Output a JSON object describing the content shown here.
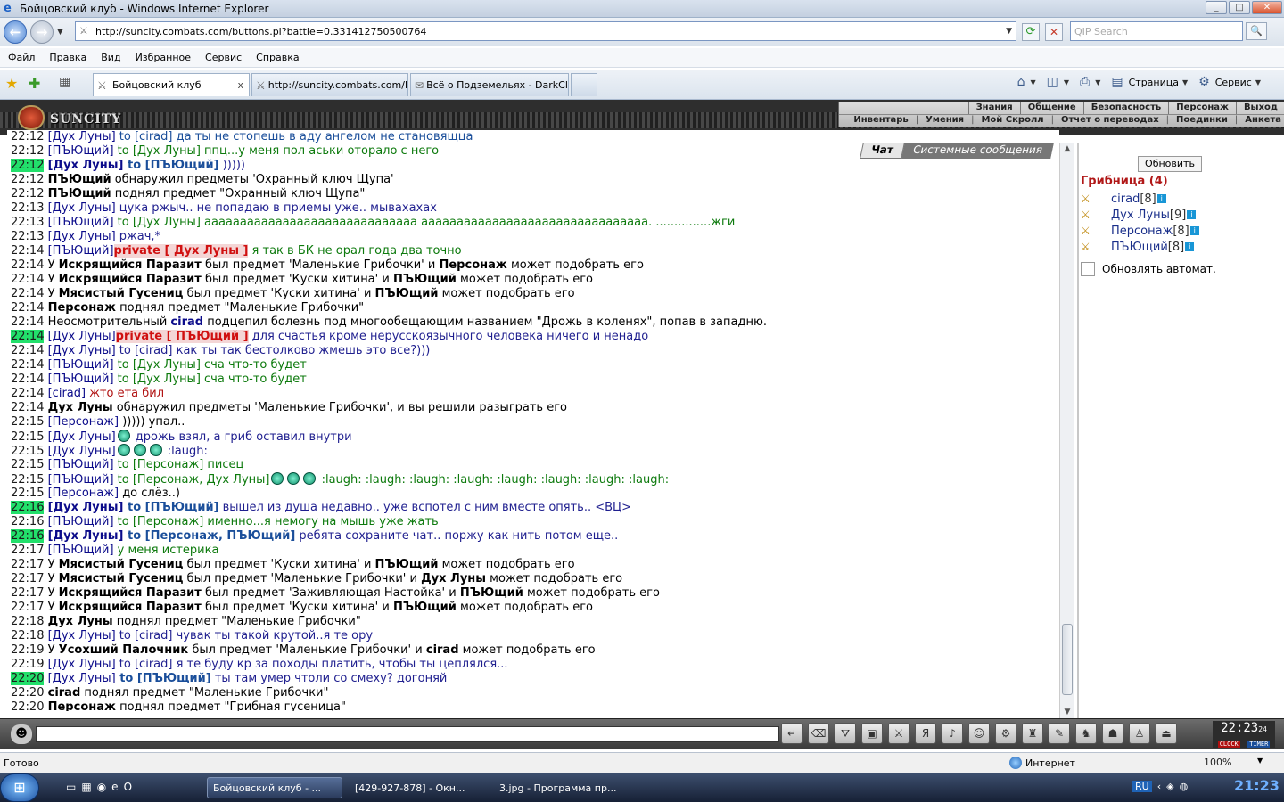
{
  "window": {
    "title": "Бойцовский клуб - Windows Internet Explorer"
  },
  "address": {
    "url": "http://suncity.combats.com/buttons.pl?battle=0.331412750500764",
    "search_placeholder": "QIP Search"
  },
  "menu": [
    "Файл",
    "Правка",
    "Вид",
    "Избранное",
    "Сервис",
    "Справка"
  ],
  "tabs": [
    {
      "label": "Бойцовский клуб",
      "close": "x"
    },
    {
      "label": "http://suncity.combats.com/l..."
    },
    {
      "label": "Всё о Подземельях - DarkCl..."
    }
  ],
  "toolbar_right": {
    "page": "Страница",
    "service": "Сервис"
  },
  "site": {
    "logo": "SUNCITY",
    "nav1": [
      "Знания",
      "Общение",
      "Безопасность",
      "Персонаж",
      "Выход"
    ],
    "nav2": [
      "Инвентарь",
      "Умения",
      "Мой Скролл",
      "Отчет о переводах",
      "Поединки",
      "Анкета"
    ]
  },
  "chat_tabs": [
    "Чат",
    "Системные сообщения"
  ],
  "chat": [
    {
      "t": "22:12",
      "parts": [
        [
          "nm",
          "[Дух Луны]"
        ],
        [
          "to",
          " to [cirad] да ты не стопешь в аду ангелом не становящца"
        ]
      ]
    },
    {
      "t": "22:12",
      "parts": [
        [
          "nm",
          "[ПЪЮщий]"
        ],
        [
          "gm",
          " to [Дух Луны] ппц...у меня пол аськи оторало с него"
        ]
      ]
    },
    {
      "t": "22:12",
      "hl": true,
      "parts": [
        [
          "nmb",
          "[Дух Луны]"
        ],
        [
          "tob",
          " to [ПЪЮщий]"
        ],
        [
          "msg",
          " )))))"
        ]
      ]
    },
    {
      "t": "22:12",
      "parts": [
        [
          "b",
          "ПЪЮщий"
        ],
        [
          "sys",
          " обнаружил предметы 'Охранный ключ Щупа'"
        ]
      ]
    },
    {
      "t": "22:12",
      "parts": [
        [
          "b",
          "ПЪЮщий"
        ],
        [
          "sys",
          " поднял предмет \"Охранный ключ Щупа\""
        ]
      ]
    },
    {
      "t": "22:13",
      "parts": [
        [
          "nm",
          "[Дух Луны]"
        ],
        [
          "msg",
          " цука ржыч.. не попадаю в приемы уже.. мывахахах"
        ]
      ]
    },
    {
      "t": "22:13",
      "parts": [
        [
          "nm",
          "[ПЪЮщий]"
        ],
        [
          "gm",
          " to [Дух Луны] аааааааааааааааааааааааааааааа аааааааааааааааааааааааааааааааа. ...............жги"
        ]
      ]
    },
    {
      "t": "22:13",
      "parts": [
        [
          "nm",
          "[Дух Луны]"
        ],
        [
          "msg",
          " ржач,*"
        ]
      ]
    },
    {
      "t": "22:14",
      "parts": [
        [
          "nm",
          "[ПЪЮщий]"
        ],
        [
          "pv",
          "private [ Дух Луны ]"
        ],
        [
          "gm",
          " я так в БК не орал года два точно"
        ]
      ]
    },
    {
      "t": "22:14",
      "parts": [
        [
          "sys",
          "У "
        ],
        [
          "b",
          "Искрящийся Паразит"
        ],
        [
          "sys",
          " был предмет 'Маленькие Грибочки' и "
        ],
        [
          "b",
          "Персонаж"
        ],
        [
          "sys",
          " может подобрать его"
        ]
      ]
    },
    {
      "t": "22:14",
      "parts": [
        [
          "sys",
          "У "
        ],
        [
          "b",
          "Искрящийся Паразит"
        ],
        [
          "sys",
          " был предмет 'Куски хитина' и "
        ],
        [
          "b",
          "ПЪЮщий"
        ],
        [
          "sys",
          " может подобрать его"
        ]
      ]
    },
    {
      "t": "22:14",
      "parts": [
        [
          "sys",
          "У "
        ],
        [
          "b",
          "Мясистый Гусениц"
        ],
        [
          "sys",
          " был предмет 'Куски хитина' и "
        ],
        [
          "b",
          "ПЪЮщий"
        ],
        [
          "sys",
          " может подобрать его"
        ]
      ]
    },
    {
      "t": "22:14",
      "parts": [
        [
          "b",
          "Персонаж"
        ],
        [
          "sys",
          " поднял предмет \"Маленькие Грибочки\""
        ]
      ]
    },
    {
      "t": "22:14",
      "parts": [
        [
          "sys",
          "Неосмотрительный "
        ],
        [
          "nmb",
          "cirad"
        ],
        [
          "sys",
          " подцепил болезнь под многообещающим названием \"Дрожь в коленях\", попав в западню."
        ]
      ]
    },
    {
      "t": "22:14",
      "hl": true,
      "parts": [
        [
          "nm",
          "[Дух Луны]"
        ],
        [
          "pv",
          "private [ ПЪЮщий ]"
        ],
        [
          "msg",
          " для счастья кроме нерусскоязычного человека ничего и ненадо"
        ]
      ]
    },
    {
      "t": "22:14",
      "parts": [
        [
          "nm",
          "[Дух Луны]"
        ],
        [
          "msg",
          " to [cirad] как ты так бестолково жмешь это все?)))"
        ]
      ]
    },
    {
      "t": "22:14",
      "parts": [
        [
          "nm",
          "[ПЪЮщий]"
        ],
        [
          "gm",
          " to [Дух Луны] сча что-то будет"
        ]
      ]
    },
    {
      "t": "22:14",
      "parts": [
        [
          "nm",
          "[ПЪЮщий]"
        ],
        [
          "gm",
          " to [Дух Луны] сча что-то будет"
        ]
      ]
    },
    {
      "t": "22:14",
      "parts": [
        [
          "nm",
          "[cirad]"
        ],
        [
          "rd",
          " жто ета бил"
        ]
      ]
    },
    {
      "t": "22:14",
      "parts": [
        [
          "b",
          "Дух Луны"
        ],
        [
          "sys",
          " обнаружил предметы 'Маленькие Грибочки', и вы решили разыграть его"
        ]
      ]
    },
    {
      "t": "22:15",
      "parts": [
        [
          "nm",
          "[Персонаж]"
        ],
        [
          "sys",
          " ))))) упал.."
        ]
      ]
    },
    {
      "t": "22:15",
      "parts": [
        [
          "nm",
          "[Дух Луны]"
        ],
        [
          "smile",
          "1"
        ],
        [
          "msg",
          " дрожь взял, а гриб оставил внутри"
        ]
      ]
    },
    {
      "t": "22:15",
      "parts": [
        [
          "nm",
          "[Дух Луны]"
        ],
        [
          "smile",
          "3"
        ],
        [
          "msg",
          " :laugh:"
        ]
      ]
    },
    {
      "t": "22:15",
      "parts": [
        [
          "nm",
          "[ПЪЮщий]"
        ],
        [
          "gm",
          " to [Персонаж] писец"
        ]
      ]
    },
    {
      "t": "22:15",
      "parts": [
        [
          "nm",
          "[ПЪЮщий]"
        ],
        [
          "gm",
          " to [Персонаж, Дух Луны]"
        ],
        [
          "smile",
          "3"
        ],
        [
          "gm",
          " :laugh: :laugh: :laugh: :laugh: :laugh: :laugh: :laugh: :laugh:"
        ]
      ]
    },
    {
      "t": "22:15",
      "parts": [
        [
          "nm",
          "[Персонаж]"
        ],
        [
          "sys",
          " до слёз..)"
        ]
      ]
    },
    {
      "t": "22:16",
      "hl": true,
      "parts": [
        [
          "nmb",
          "[Дух Луны]"
        ],
        [
          "tob",
          " to [ПЪЮщий]"
        ],
        [
          "msg",
          " вышел из душа недавно.. уже вспотел с ним вместе опять.. <ВЦ>"
        ]
      ]
    },
    {
      "t": "22:16",
      "parts": [
        [
          "nm",
          "[ПЪЮщий]"
        ],
        [
          "gm",
          " to [Персонаж] именно...я немогу на мышь уже жать"
        ]
      ]
    },
    {
      "t": "22:16",
      "hl": true,
      "parts": [
        [
          "nmb",
          "[Дух Луны]"
        ],
        [
          "tob",
          " to [Персонаж, ПЪЮщий]"
        ],
        [
          "msg",
          " ребята сохраните чат.. поржу как нить потом еще.."
        ]
      ]
    },
    {
      "t": "22:17",
      "parts": [
        [
          "nm",
          "[ПЪЮщий]"
        ],
        [
          "gm",
          " у меня истерика"
        ]
      ]
    },
    {
      "t": "22:17",
      "parts": [
        [
          "sys",
          "У "
        ],
        [
          "b",
          "Мясистый Гусениц"
        ],
        [
          "sys",
          " был предмет 'Куски хитина' и "
        ],
        [
          "b",
          "ПЪЮщий"
        ],
        [
          "sys",
          " может подобрать его"
        ]
      ]
    },
    {
      "t": "22:17",
      "parts": [
        [
          "sys",
          "У "
        ],
        [
          "b",
          "Мясистый Гусениц"
        ],
        [
          "sys",
          " был предмет 'Маленькие Грибочки' и "
        ],
        [
          "b",
          "Дух Луны"
        ],
        [
          "sys",
          " может подобрать его"
        ]
      ]
    },
    {
      "t": "22:17",
      "parts": [
        [
          "sys",
          "У "
        ],
        [
          "b",
          "Искрящийся Паразит"
        ],
        [
          "sys",
          " был предмет 'Заживляющая Настойка' и "
        ],
        [
          "b",
          "ПЪЮщий"
        ],
        [
          "sys",
          " может подобрать его"
        ]
      ]
    },
    {
      "t": "22:17",
      "parts": [
        [
          "sys",
          "У "
        ],
        [
          "b",
          "Искрящийся Паразит"
        ],
        [
          "sys",
          " был предмет 'Куски хитина' и "
        ],
        [
          "b",
          "ПЪЮщий"
        ],
        [
          "sys",
          " может подобрать его"
        ]
      ]
    },
    {
      "t": "22:18",
      "parts": [
        [
          "b",
          "Дух Луны"
        ],
        [
          "sys",
          " поднял предмет \"Маленькие Грибочки\""
        ]
      ]
    },
    {
      "t": "22:18",
      "parts": [
        [
          "nm",
          "[Дух Луны]"
        ],
        [
          "msg",
          " to [cirad] чувак ты такой крутой..я те ору"
        ]
      ]
    },
    {
      "t": "22:19",
      "parts": [
        [
          "sys",
          "У "
        ],
        [
          "b",
          "Усохший Палочник"
        ],
        [
          "sys",
          " был предмет 'Маленькие Грибочки' и "
        ],
        [
          "b",
          "cirad"
        ],
        [
          "sys",
          " может подобрать его"
        ]
      ]
    },
    {
      "t": "22:19",
      "parts": [
        [
          "nm",
          "[Дух Луны]"
        ],
        [
          "msg",
          " to [cirad] я те буду кр за походы платить, чтобы ты цеплялся..."
        ]
      ]
    },
    {
      "t": "22:20",
      "hl": true,
      "parts": [
        [
          "nm",
          "[Дух Луны]"
        ],
        [
          "tob",
          " to [ПЪЮщий]"
        ],
        [
          "msg",
          " ты там умер чтоли со смеху? догоняй"
        ]
      ]
    },
    {
      "t": "22:20",
      "parts": [
        [
          "b",
          "cirad"
        ],
        [
          "sys",
          " поднял предмет \"Маленькие Грибочки\""
        ]
      ]
    },
    {
      "t": "22:20",
      "parts": [
        [
          "b",
          "Персонаж"
        ],
        [
          "sys",
          " поднял предмет \"Грибная гусеница\""
        ]
      ]
    }
  ],
  "side": {
    "refresh_label": "Обновить",
    "room": "Грибница (4)",
    "players": [
      {
        "name": "cirad",
        "level": "[8]"
      },
      {
        "name": "Дух Луны",
        "level": "[9]"
      },
      {
        "name": "Персонаж",
        "level": "[8]"
      },
      {
        "name": "ПЪЮщий",
        "level": "[8]"
      }
    ],
    "auto_label": "Обновлять автомат."
  },
  "clock": {
    "time": "22:23",
    "sec": "24",
    "clock_label": "CLOCK",
    "timer_label": "TIMER",
    "exit": "EXIT"
  },
  "status": {
    "ready": "Готово",
    "zone": "Интернет",
    "zoom": "100%"
  },
  "taskbar": {
    "tasks": [
      "Бойцовский клуб - ...",
      "[429-927-878] - Окн...",
      "3.jpg - Программа пр..."
    ],
    "lang": "RU",
    "time": "21:23"
  }
}
